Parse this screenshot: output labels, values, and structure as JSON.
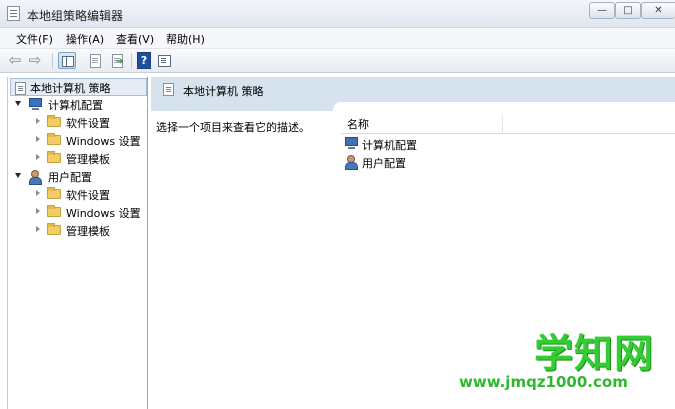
{
  "window": {
    "title": "本地组策略编辑器"
  },
  "title_buttons": {
    "minimize": "—",
    "maximize": "□",
    "close": "✕"
  },
  "menu": [
    "文件(F)",
    "操作(A)",
    "查看(V)",
    "帮助(H)"
  ],
  "toolbar": {
    "items": [
      "back-icon",
      "forward-icon",
      "show-hide-tree-icon",
      "properties-icon",
      "export-list-icon",
      "help-icon",
      "extended-view-icon"
    ],
    "help_glyph": "?"
  },
  "tree": {
    "root": "本地计算机 策略",
    "computer": {
      "label": "计算机配置",
      "children": [
        "软件设置",
        "Windows 设置",
        "管理模板"
      ]
    },
    "user": {
      "label": "用户配置",
      "children": [
        "软件设置",
        "Windows 设置",
        "管理模板"
      ]
    }
  },
  "content": {
    "header": "本地计算机 策略",
    "description": "选择一个项目来查看它的描述。",
    "column_name": "名称",
    "items": [
      "计算机配置",
      "用户配置"
    ]
  },
  "watermark": {
    "title": "学知网",
    "url": "www.jmqz1000.com"
  },
  "colors": {
    "header_band": "#d6e2ee",
    "folder": "#f0cd66",
    "watermark": "#33cc33"
  }
}
